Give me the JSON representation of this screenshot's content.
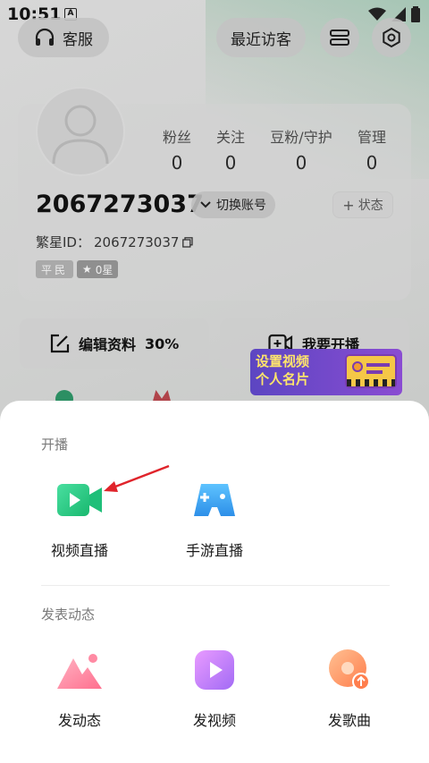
{
  "status_bar": {
    "time": "10:51",
    "notification_letter": "A"
  },
  "header": {
    "customer_service_label": "客服",
    "recent_visitors_label": "最近访客"
  },
  "profile": {
    "stats": [
      {
        "label": "粉丝",
        "value": "0"
      },
      {
        "label": "关注",
        "value": "0"
      },
      {
        "label": "豆粉/守护",
        "value": "0"
      },
      {
        "label": "管理",
        "value": "0"
      }
    ],
    "username": "2067273037",
    "switch_account_label": "切换账号",
    "status_label": "状态",
    "fanxing_id_label": "繁星ID：",
    "fanxing_id": "2067273037",
    "rank_badge": "平民",
    "star_badge": "0星"
  },
  "actions": {
    "edit_profile_label": "编辑资料",
    "edit_profile_percent": "30%",
    "start_live_label": "我要开播"
  },
  "promo": {
    "line1": "设置视频",
    "line2": "个人名片"
  },
  "sheet": {
    "live_section_title": "开播",
    "live_items": [
      {
        "label": "视频直播",
        "icon": "video-camera-icon"
      },
      {
        "label": "手游直播",
        "icon": "gamepad-icon"
      }
    ],
    "post_section_title": "发表动态",
    "post_items": [
      {
        "label": "发动态",
        "icon": "mountain-image-icon"
      },
      {
        "label": "发视频",
        "icon": "play-video-icon"
      },
      {
        "label": "发歌曲",
        "icon": "music-disc-icon"
      }
    ]
  },
  "colors": {
    "video_live_green": "#2fd38a",
    "game_live_blue": "#3aa6f0",
    "arrow_red": "#e0242b"
  }
}
